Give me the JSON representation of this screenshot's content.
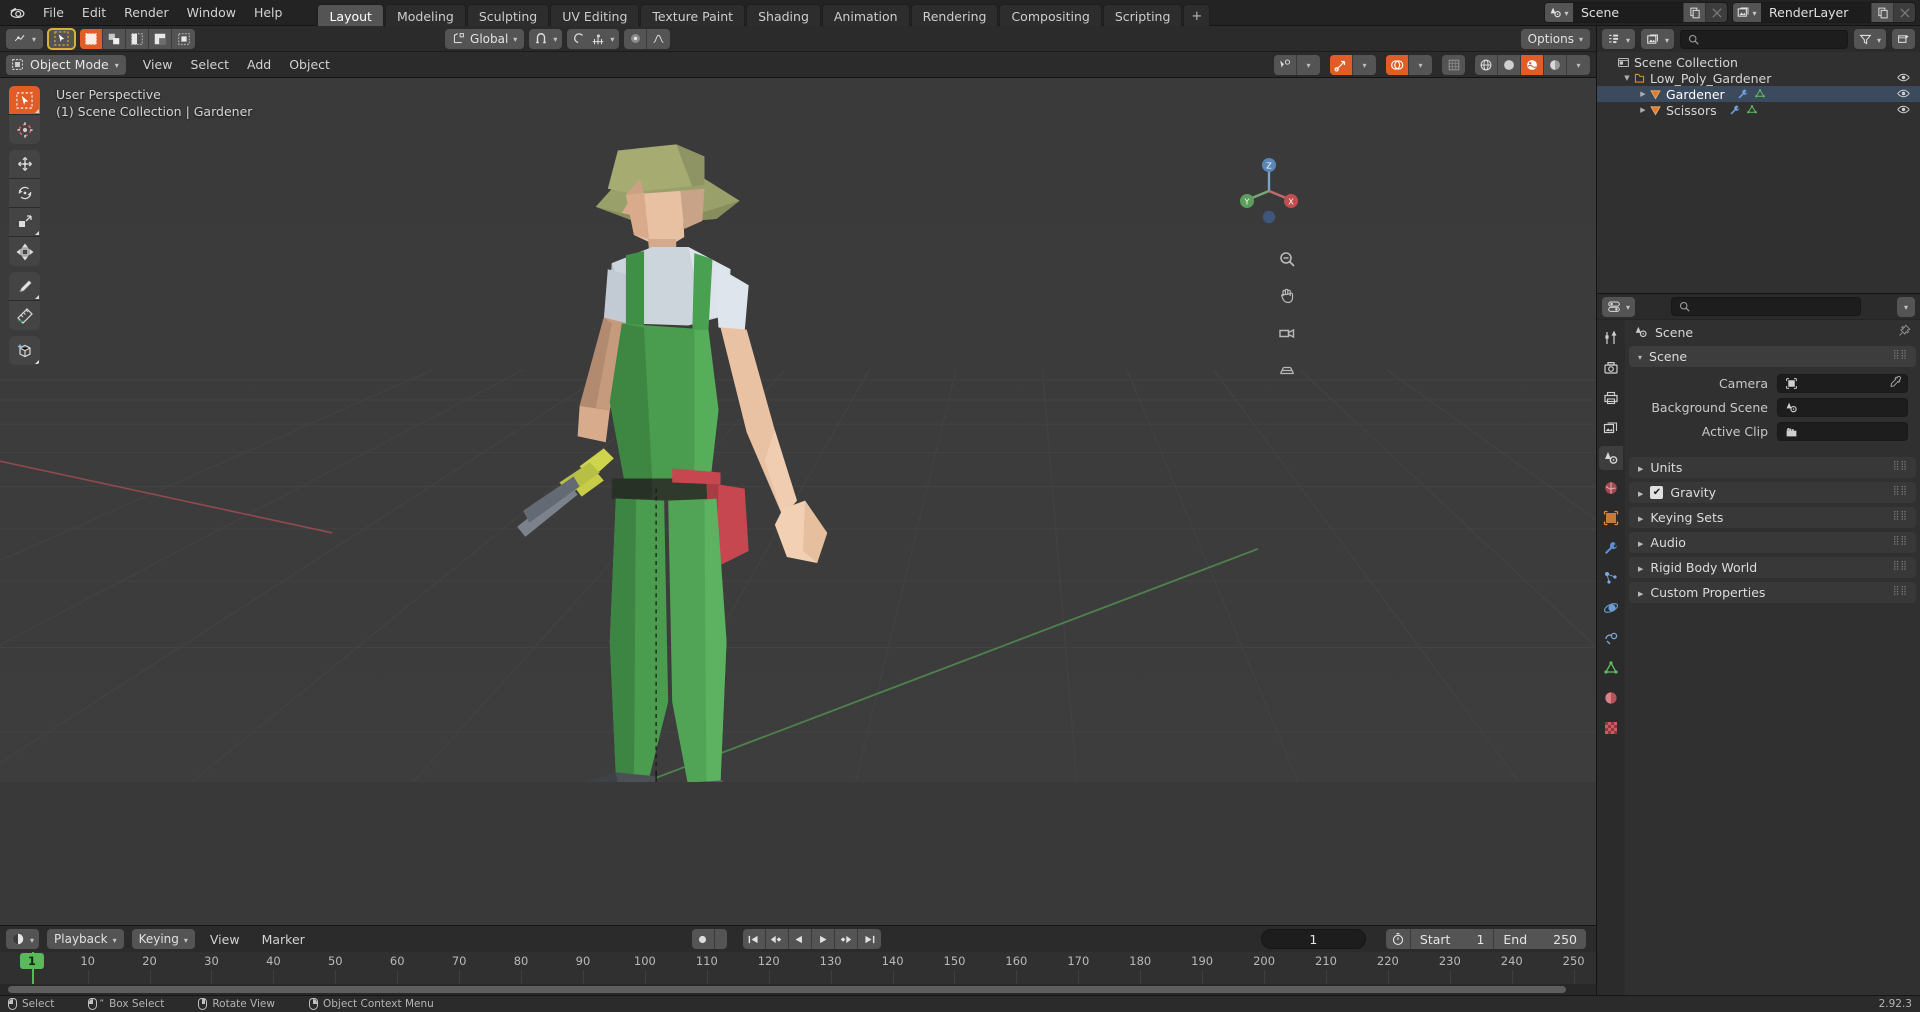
{
  "app": {
    "version": "2.92.3",
    "logo_icon": "blender-logo-icon"
  },
  "topbar": {
    "menus": [
      "File",
      "Edit",
      "Render",
      "Window",
      "Help"
    ],
    "workspace_tabs": [
      {
        "label": "Layout",
        "active": true
      },
      {
        "label": "Modeling",
        "active": false
      },
      {
        "label": "Sculpting",
        "active": false
      },
      {
        "label": "UV Editing",
        "active": false
      },
      {
        "label": "Texture Paint",
        "active": false
      },
      {
        "label": "Shading",
        "active": false
      },
      {
        "label": "Animation",
        "active": false
      },
      {
        "label": "Rendering",
        "active": false
      },
      {
        "label": "Compositing",
        "active": false
      },
      {
        "label": "Scripting",
        "active": false
      }
    ],
    "add_workspace_label": "+",
    "scene_block": {
      "icon": "scene-icon",
      "value": "Scene",
      "new_btn": "copy-icon",
      "unlink_btn": "x-icon"
    },
    "viewlayer_block": {
      "icon": "view-layer-icon",
      "value": "RenderLayer",
      "new_btn": "copy-icon",
      "unlink_btn": "x-icon"
    }
  },
  "viewport": {
    "tool_header": {
      "active_tool_icon": "tweak-cursor-icon",
      "select_modes": [
        "select-new-icon",
        "select-extend-icon",
        "select-subtract-icon",
        "select-invert-icon",
        "select-intersect-icon"
      ],
      "transform_orientation": "Global",
      "snap_icon": "magnet-icon",
      "proportional_icon": "proportional-edit-icon",
      "options_label": "Options"
    },
    "header": {
      "mode": "Object Mode",
      "menus": [
        "View",
        "Select",
        "Add",
        "Object"
      ],
      "visibility_icon": "show-gizmo-icon",
      "gizmo_icon": "gizmo-icon",
      "overlays_icon": "overlays-icon",
      "xray_icon": "xray-icon",
      "shading_modes": [
        "wireframe-icon",
        "solid-icon",
        "material-preview-icon",
        "rendered-icon"
      ],
      "shading_active_index": 2
    },
    "overlay_line1": "User Perspective",
    "overlay_line2": "(1) Scene Collection | Gardener",
    "toolbar": [
      {
        "name": "tweak-tool",
        "icon": "cursor-arrow-icon",
        "active": true
      },
      {
        "name": "cursor-tool",
        "icon": "3d-cursor-icon",
        "active": false
      },
      {
        "name": "move-tool",
        "icon": "move-arrows-icon",
        "active": false
      },
      {
        "name": "rotate-tool",
        "icon": "rotate-icon",
        "active": false
      },
      {
        "name": "scale-tool",
        "icon": "scale-icon",
        "active": false
      },
      {
        "name": "transform-tool",
        "icon": "transform-icon",
        "active": false
      },
      {
        "name": "annotate-tool",
        "icon": "pencil-icon",
        "active": false
      },
      {
        "name": "measure-tool",
        "icon": "ruler-icon",
        "active": false
      },
      {
        "name": "add-cube-tool",
        "icon": "add-cube-icon",
        "active": false
      }
    ],
    "nav_icons": [
      "zoom-icon",
      "pan-hand-icon",
      "camera-view-icon",
      "ortho-persp-icon"
    ],
    "gizmo_axes": {
      "x": "X",
      "y": "Y",
      "z": "Z"
    }
  },
  "outliner": {
    "display_mode_icon": "outliner-display-icon",
    "filter_id_icon": "view-layer-icon",
    "search_placeholder": "",
    "filter_icon": "filter-funnel-icon",
    "new_collection_icon": "new-collection-icon",
    "rows": [
      {
        "label": "Scene Collection",
        "indent": 0,
        "icon": "collection-icon",
        "expander": "",
        "selected": false,
        "eye": false,
        "extra": []
      },
      {
        "label": "Low_Poly_Gardener",
        "indent": 1,
        "icon": "collection-orange-icon",
        "expander": "down",
        "selected": false,
        "eye": true,
        "extra": []
      },
      {
        "label": "Gardener",
        "indent": 2,
        "icon": "mesh-object-icon",
        "expander": "right",
        "selected": true,
        "eye": true,
        "extra": [
          "modifier-wrench-icon",
          "mesh-data-icon"
        ]
      },
      {
        "label": "Scissors",
        "indent": 2,
        "icon": "mesh-object-icon",
        "expander": "right",
        "selected": false,
        "eye": true,
        "extra": [
          "modifier-wrench-icon",
          "mesh-data-icon"
        ]
      }
    ]
  },
  "properties": {
    "editor_icon": "properties-editor-icon",
    "search_placeholder": "",
    "breadcrumb": {
      "icon": "scene-props-icon",
      "label": "Scene"
    },
    "tabs": [
      {
        "name": "tool-tab",
        "icon": "tool-icon",
        "active": false
      },
      {
        "name": "render-tab",
        "icon": "camera-back-icon",
        "active": false
      },
      {
        "name": "output-tab",
        "icon": "printer-icon",
        "active": false
      },
      {
        "name": "view-layer-tab",
        "icon": "images-icon",
        "active": false
      },
      {
        "name": "scene-tab",
        "icon": "scene-props-icon",
        "active": true
      },
      {
        "name": "world-tab",
        "icon": "world-globe-icon",
        "active": false
      },
      {
        "name": "object-tab",
        "icon": "object-square-icon",
        "active": false
      },
      {
        "name": "modifier-tab",
        "icon": "wrench-icon",
        "active": false
      },
      {
        "name": "particles-tab",
        "icon": "particles-icon",
        "active": false
      },
      {
        "name": "physics-tab",
        "icon": "physics-orbit-icon",
        "active": false
      },
      {
        "name": "constraints-tab",
        "icon": "constraint-icon",
        "active": false
      },
      {
        "name": "data-tab",
        "icon": "mesh-data-icon",
        "active": false
      },
      {
        "name": "material-tab",
        "icon": "material-sphere-icon",
        "active": false
      },
      {
        "name": "texture-tab",
        "icon": "checker-texture-icon",
        "active": false
      }
    ],
    "scene_panel": {
      "title": "Scene",
      "open": true,
      "fields": [
        {
          "label": "Camera",
          "icon": "camera-object-icon",
          "value": "",
          "eyedropper": true
        },
        {
          "label": "Background Scene",
          "icon": "scene-props-icon",
          "value": "",
          "eyedropper": false
        },
        {
          "label": "Active Clip",
          "icon": "movie-clip-icon",
          "value": "",
          "eyedropper": false
        }
      ]
    },
    "closed_panels": [
      {
        "label": "Units",
        "checkbox": null
      },
      {
        "label": "Gravity",
        "checkbox": true
      },
      {
        "label": "Keying Sets",
        "checkbox": null
      },
      {
        "label": "Audio",
        "checkbox": null
      },
      {
        "label": "Rigid Body World",
        "checkbox": null
      },
      {
        "label": "Custom Properties",
        "checkbox": null
      }
    ]
  },
  "timeline": {
    "editor_icon": "timeline-editor-icon",
    "menus": [
      "Playback",
      "Keying",
      "View",
      "Marker"
    ],
    "playback_dropdown": "Playback",
    "keying_dropdown": "Keying",
    "transport": [
      "jump-start-icon",
      "prev-keyframe-icon",
      "play-reverse-icon",
      "play-icon",
      "next-keyframe-icon",
      "jump-end-icon"
    ],
    "record_icon": "record-icon",
    "current_frame": "1",
    "auto_key_icon": "stopwatch-icon",
    "start_label": "Start",
    "start_value": "1",
    "end_label": "End",
    "end_value": "250",
    "ticks": [
      1,
      10,
      20,
      30,
      40,
      50,
      60,
      70,
      80,
      90,
      100,
      110,
      120,
      130,
      140,
      150,
      160,
      170,
      180,
      190,
      200,
      210,
      220,
      230,
      240,
      250
    ],
    "playhead_frame": 1,
    "range_start": 1,
    "range_end": 250
  },
  "statusbar": {
    "items": [
      {
        "mouse": "left",
        "label": "Select"
      },
      {
        "mouse": "left-drag",
        "label": "Box Select"
      },
      {
        "mouse": "middle",
        "label": "Rotate View"
      },
      {
        "mouse": "right",
        "label": "Object Context Menu"
      }
    ],
    "version": "2.92.3"
  },
  "colors": {
    "accent_orange": "#e05d28",
    "accent_blue": "#4772b3",
    "green_playhead": "#5bb85b",
    "bg_dark": "#1d1d1d",
    "bg_panel": "#303030",
    "bg_header": "#2b2b2b",
    "viewport_bg": "#393939"
  }
}
